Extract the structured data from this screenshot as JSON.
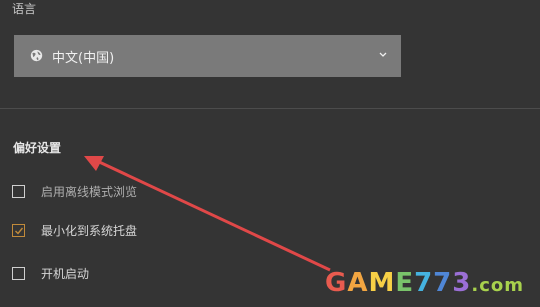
{
  "language": {
    "label": "语言",
    "selected": "中文(中国)"
  },
  "preferences": {
    "title": "偏好设置",
    "options": [
      {
        "label": "启用离线模式浏览",
        "checked": false
      },
      {
        "label": "最小化到系统托盘",
        "checked": true
      },
      {
        "label": "开机启动",
        "checked": false
      }
    ]
  },
  "watermark": {
    "text": "GAME773",
    "suffix": ".com"
  },
  "colors": {
    "background": "#343434",
    "select": "#7a7a7a",
    "check": "#c18a3a",
    "arrow": "#e04848"
  }
}
